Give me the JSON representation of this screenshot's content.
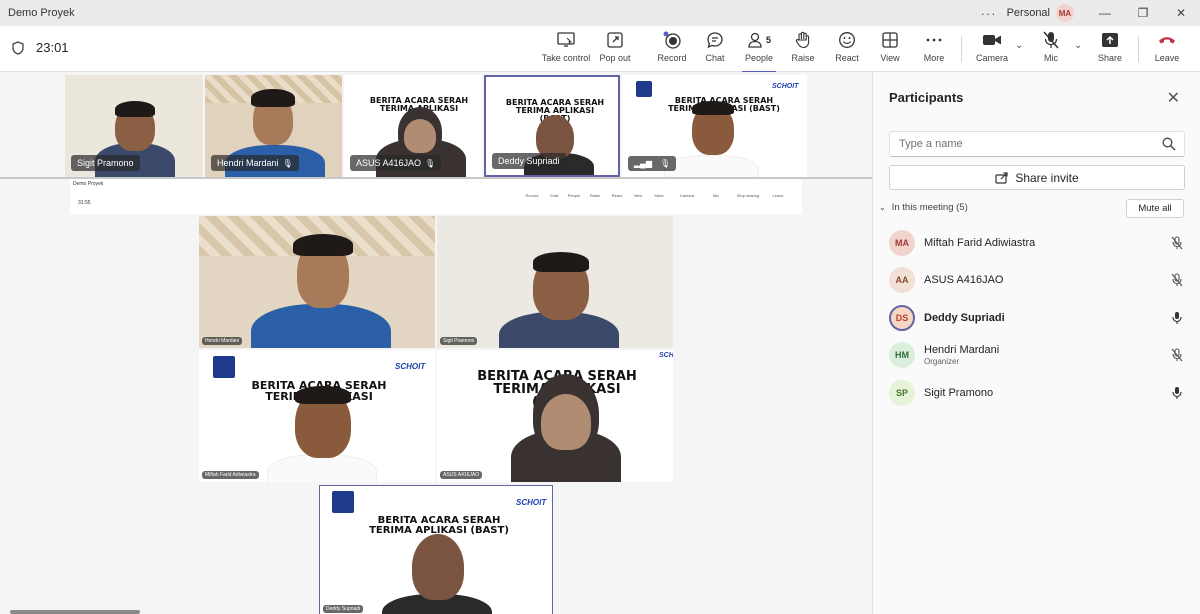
{
  "titlebar": {
    "title": "Demo Proyek",
    "dots": "···",
    "profile": "Personal",
    "avatar": "MA",
    "minimize": "—",
    "restore": "❐",
    "close": "✕"
  },
  "toolbar": {
    "timer": "23:01",
    "buttons": [
      {
        "label": "Take control",
        "icon": "take-control-icon"
      },
      {
        "label": "Pop out",
        "icon": "pop-out-icon"
      },
      {
        "label": "Record",
        "icon": "record-icon"
      },
      {
        "label": "Chat",
        "icon": "chat-icon"
      },
      {
        "label": "People",
        "icon": "people-icon",
        "count": "5"
      },
      {
        "label": "Raise",
        "icon": "raise-hand-icon"
      },
      {
        "label": "React",
        "icon": "react-icon"
      },
      {
        "label": "View",
        "icon": "view-icon"
      },
      {
        "label": "More",
        "icon": "more-icon"
      },
      {
        "label": "Camera",
        "icon": "camera-icon"
      },
      {
        "label": "Mic",
        "icon": "mic-off-icon"
      },
      {
        "label": "Share",
        "icon": "share-icon"
      },
      {
        "label": "Leave",
        "icon": "leave-icon"
      }
    ]
  },
  "stage": {
    "top_tiles": [
      {
        "name": "Sigit Pramono"
      },
      {
        "name": "Hendri Mardani"
      },
      {
        "name": "ASUS A416JAO"
      },
      {
        "name": "Deddy Supriadi"
      },
      {
        "name": ""
      }
    ],
    "slide_title_line1": "BERITA ACARA SERAH",
    "slide_title_line2": "TERIMA APLIKASI (BAST)",
    "slide_brand": "SCHOIT",
    "nested": {
      "window_title": "Demo Proyek",
      "timer": "31:55",
      "mini_labels": [
        "Record",
        "Chat",
        "People",
        "Raise",
        "React",
        "View",
        "More",
        "Camera",
        "Mic",
        "Stop sharing",
        "Leave"
      ]
    },
    "grid_tiles": [
      {
        "name": "Hendri Mardani"
      },
      {
        "name": "Sigit Pramono"
      },
      {
        "name": "Miftah Farid Adiwiastra"
      },
      {
        "name": "ASUS A416JAO"
      },
      {
        "name": "Deddy Supriadi"
      }
    ]
  },
  "panel": {
    "title": "Participants",
    "search_placeholder": "Type a name",
    "share_invite": "Share invite",
    "in_meeting": "In this meeting (5)",
    "mute_all": "Mute all",
    "participants": [
      {
        "initials": "MA",
        "name": "Miftah Farid Adiwiastra",
        "role": "",
        "mic": "muted",
        "color": "#f2d4cf",
        "fg": "#a4373a"
      },
      {
        "initials": "AA",
        "name": "ASUS A416JAO",
        "role": "",
        "mic": "muted",
        "color": "#f0e0d6",
        "fg": "#8a4a2b"
      },
      {
        "initials": "DS",
        "name": "Deddy Supriadi",
        "role": "",
        "mic": "on",
        "color": "#f7d7c4",
        "fg": "#b5422a"
      },
      {
        "initials": "HM",
        "name": "Hendri Mardani",
        "role": "Organizer",
        "mic": "muted",
        "color": "#dcefdc",
        "fg": "#2f6f3a"
      },
      {
        "initials": "SP",
        "name": "Sigit Pramono",
        "role": "",
        "mic": "on",
        "color": "#e6f2d9",
        "fg": "#49752a"
      }
    ]
  },
  "colors": {
    "accent": "#5b5fc7",
    "leave": "#c4314b"
  }
}
